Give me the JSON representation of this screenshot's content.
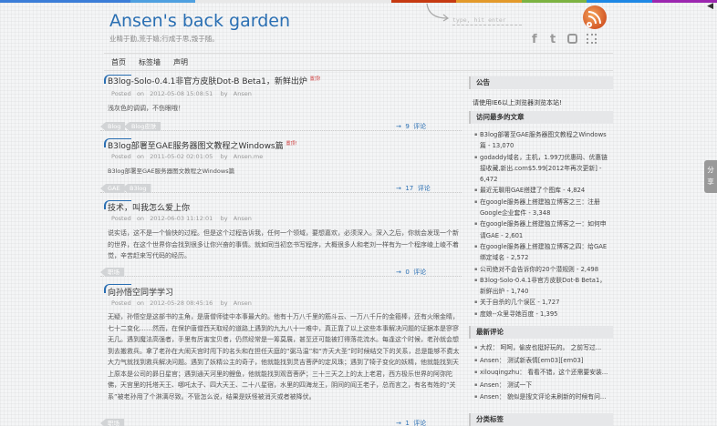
{
  "top_colors": [
    "#3b7dd8",
    "#3b7dd8",
    "#4ea0e0",
    "#e8e8e8",
    "#e8e8e8",
    "#e8e8e8",
    "#c63a12",
    "#e39a2b",
    "#7cb342",
    "#1e88e5",
    "#9c27b0"
  ],
  "site": {
    "title": "Ansen's back garden",
    "subtitle": "业精于勤,荒于嬉;行成于思,毁于随。"
  },
  "search": {
    "placeholder": "type, hit enter"
  },
  "social_icons": [
    "facebook-icon",
    "twitter-icon",
    "sina-weibo-icon",
    "rss-grid-icon"
  ],
  "nav": {
    "items": [
      "首页",
      "标签墙",
      "声明"
    ]
  },
  "posts": [
    {
      "title": "B3log-Solo-0.4.1非官方皮肤Dot-B Beta1，新鲜出炉",
      "badge": "置顶!",
      "posted_label": "Posted",
      "on_label": "on",
      "date": "2012-05-08 15:08:51",
      "by_label": "by",
      "author": "Ansen",
      "excerpt": "浅灰色的调调，不伤眼哦！",
      "tags": [
        "Blog",
        "Blog皮肤"
      ],
      "comment_count": "9",
      "comment_label": "评论"
    },
    {
      "title": "B3log部署至GAE服务器图文教程之Windows篇",
      "badge": "置顶!",
      "posted_label": "Posted",
      "on_label": "on",
      "date": "2011-05-02 02:01:05",
      "by_label": "by",
      "author": "Ansen.me",
      "excerpt": "B3log部署至GAE服务器图文教程之Windows篇",
      "tags": [
        "GAE",
        "B3log"
      ],
      "comment_count": "17",
      "comment_label": "评论"
    },
    {
      "title": "技术，叫我怎么爱上你",
      "badge": "",
      "posted_label": "Posted",
      "on_label": "on",
      "date": "2012-06-03 11:12:01",
      "by_label": "by",
      "author": "Ansen",
      "excerpt": "说实话，这不是一个愉快的过程。但是这个过程告诉我，任何一个领域，要想嘉欢，必须深入。深入之后，你就会发现一个新的世界，在这个世界你会找到很多让你兴奋的事情。就如同当初恋书写程序，大概很多人和老刘一样有为一个程序崚上崚不着觉，辛苦赶来写代码的经历。",
      "tags": [
        "职场"
      ],
      "comment_count": "0",
      "comment_label": "评论"
    },
    {
      "title": "向孙悟空同学学习",
      "badge": "",
      "posted_label": "Posted",
      "on_label": "on",
      "date": "2012-05-28 08:45:16",
      "by_label": "by",
      "author": "Ansen",
      "excerpt": "无疑，孙悟空是这部书的主角，是唐僧师徒中本事最大的。他有十万八千里的筋斗云、一万八千斤的金箍棒，还有火眼金睛，七十二变化……然而，在保护唐僧西天取经的道路上遇到的九九八十一难中，真正靠了以上这些本事解决问题的证据本是寥寥无几。遇到魔法高强者，手里有厉害宝贝者，仍然经常是一筹莫展，甚至还可能被打得落花流水。每逢这个时候，老孙就会想到去搬救兵。拿了老孙在大闹天宫时闯下的名头和在担任天庭的“弼马温”和“齐天大圣”时时候结交下的关系，总是能够不费太大力气就找到救兵解决问题。遇到了妖精公主的奇子，他就能找到灵吉菩萨的定风珠；遇到了犄子变化的妖精，他就能找到天上原本是公司的昴日星官；遇到通天河里的鲤鱼，他就能找到观音菩萨；三十三天之上的太上老君，西方极乐世界的阿弥陀佛，天宫里的托塔天王、哪吒太子、四大天王、二十八星宿，水里的四海龙王，阴间的阎王老子，总而言之，有名有姓的“关系”被老孙用了个淋漓尽致。不管怎么说，结果是妖怪被消灭或者被降伏。",
      "tags": [
        "职场"
      ],
      "comment_count": "1",
      "comment_label": "评论"
    }
  ],
  "sidebar": {
    "notice": {
      "title": "公告",
      "text": "请使用IE6以上浏览器浏览本站!"
    },
    "most_visited": {
      "title": "访问最多的文章",
      "items": [
        "B3log部署至GAE服务器图文教程之Windows篇 - 13,070",
        "godaddy域名，主机，1.99刀优惠码、优惠链接收藏,新出.com$5.99[2012年再次更新] - 6,472",
        "最近无聊用GAE搭建了个图库 - 4,824",
        "在google服务器上搭建独立博客之三：注册Google企业套件 - 3,348",
        "在google服务器上搭建独立博客之一：如何申请GAE - 2,601",
        "在google服务器上搭建独立博客之四：给GAE绑定域名 - 2,572",
        "公司绝对不会告诉你的20个潜规则 - 2,498",
        "B3log-Solo-0.4.1非官方皮肤Dot-B Beta1，新鲜出炉 - 1,740",
        "关于自杀的几个误区 - 1,727",
        "度娘--众里寻她百度 - 1,395"
      ]
    },
    "recent_comments": {
      "title": "最新评论",
      "items": [
        "大叔： 呵呵，偷皮也挺好玩的。 之前写过...",
        "Ansen： 测试新表情[em03][em03]",
        "xilouqingzhu： 看看不错，这个还需要安装...",
        "Ansen： 测试一下",
        "Ansen： 貌似是搜文评论未刷新的时候有问..."
      ]
    },
    "tags_title": "分类标签"
  },
  "share": {
    "label": "分享"
  }
}
